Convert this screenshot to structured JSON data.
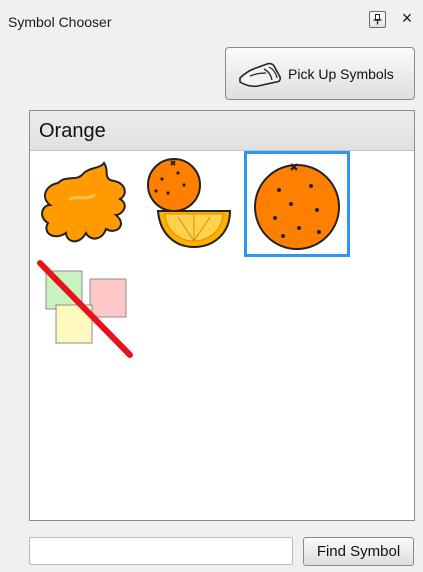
{
  "window": {
    "title": "Symbol Chooser"
  },
  "toolbar": {
    "pickup_label": "Pick Up Symbols"
  },
  "grid": {
    "header": "Orange",
    "symbols": [
      {
        "icon": "orange-splat-icon"
      },
      {
        "icon": "orange-fruit-slice-icon"
      },
      {
        "icon": "orange-fruit-icon",
        "selected": true
      },
      {
        "icon": "no-symbol-icon"
      }
    ]
  },
  "search": {
    "value": "",
    "placeholder": "",
    "button_label": "Find Symbol"
  },
  "colors": {
    "accent": "#2e97f0",
    "orange": "#ff8a00",
    "orange_light": "#ffb000"
  }
}
